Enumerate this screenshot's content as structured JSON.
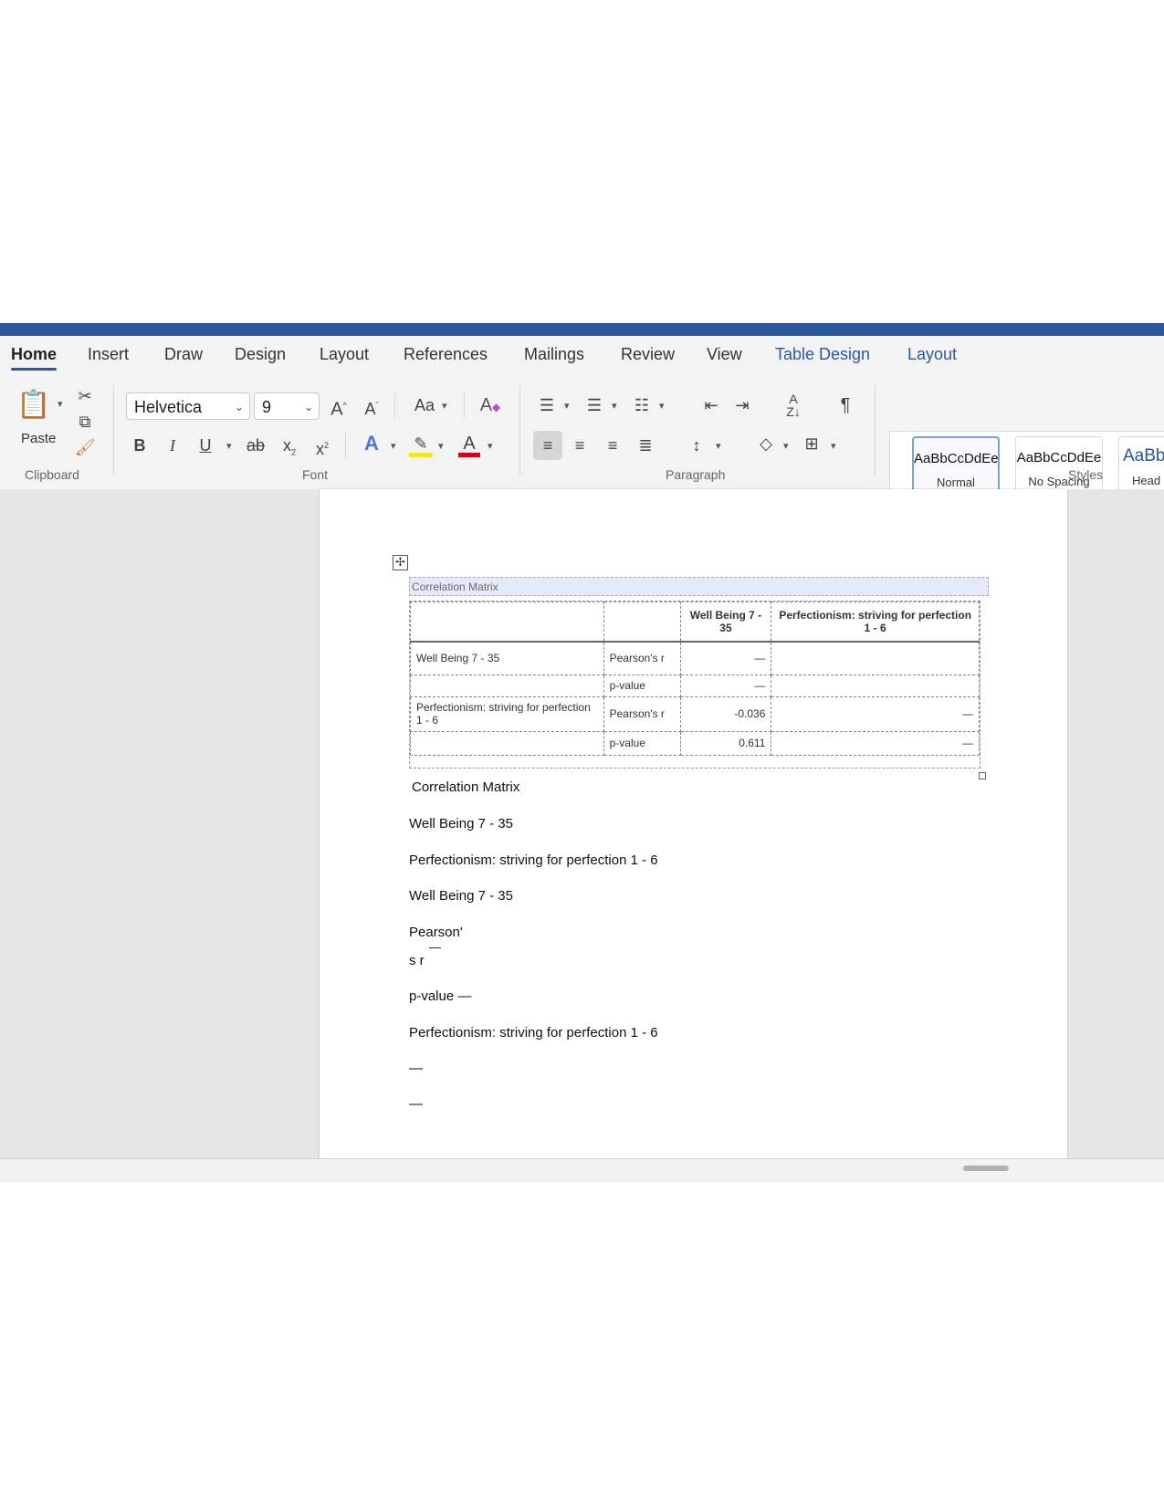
{
  "ribbon": {
    "tabs": [
      "Home",
      "Insert",
      "Draw",
      "Design",
      "Layout",
      "References",
      "Mailings",
      "Review",
      "View",
      "Table Design",
      "Layout"
    ],
    "groups": {
      "clipboard": "Clipboard",
      "font": "Font",
      "paragraph": "Paragraph",
      "styles": "Styles"
    },
    "paste_label": "Paste",
    "font_name": "Helvetica",
    "font_size": "9",
    "styles": [
      {
        "preview": "AaBbCcDdEe",
        "name": "Normal"
      },
      {
        "preview": "AaBbCcDdEe",
        "name": "No Spacing"
      },
      {
        "preview": "AaBb",
        "name": "Head"
      }
    ]
  },
  "document": {
    "caption": "Correlation Matrix",
    "table": {
      "headers": [
        "",
        "",
        "Well Being 7 - 35",
        "Perfectionism: striving for perfection 1 - 6"
      ],
      "rows": [
        [
          "Well Being 7 - 35",
          "Pearson's r",
          "—",
          ""
        ],
        [
          "",
          "p-value",
          "—",
          ""
        ],
        [
          "Perfectionism: striving for perfection 1 - 6",
          "Pearson's r",
          "-0.036",
          "—"
        ],
        [
          "",
          "p-value",
          "0.611",
          "—"
        ]
      ]
    },
    "paragraphs": [
      "Correlation Matrix",
      "Well Being 7 - 35",
      "Perfectionism: striving for perfection 1 - 6",
      "Well Being 7 - 35",
      "Pearson'",
      "s r",
      "—",
      "p-value —",
      "Perfectionism: striving for perfection 1 - 6",
      "—",
      "—"
    ]
  },
  "colors": {
    "accent": "#2b579a",
    "caption_highlight": "#e3ebfb",
    "highlighter": "#f5e625",
    "font_color": "#d0021b"
  }
}
